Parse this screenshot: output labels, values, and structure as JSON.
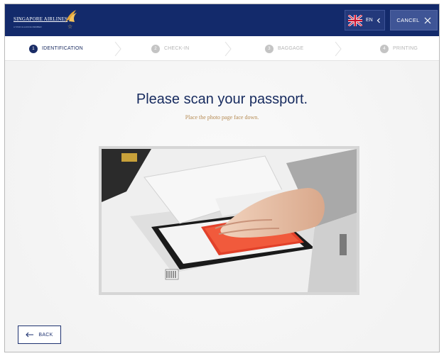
{
  "header": {
    "airline_name": "SINGAPORE AIRLINES",
    "tagline": "A STAR ALLIANCE MEMBER",
    "language_code": "EN",
    "cancel_label": "CANCEL"
  },
  "steps": [
    {
      "number": "1",
      "label": "IDENTIFICATION",
      "active": true
    },
    {
      "number": "2",
      "label": "CHECK-IN",
      "active": false
    },
    {
      "number": "3",
      "label": "BAGGAGE",
      "active": false
    },
    {
      "number": "4",
      "label": "PRINTING",
      "active": false
    }
  ],
  "main": {
    "title": "Please scan your passport.",
    "instruction": "Place the photo page face down."
  },
  "footer": {
    "back_label": "BACK"
  },
  "colors": {
    "brand_navy": "#132a6b",
    "brand_gold": "#d7b25d",
    "instruction_text": "#b58a52"
  }
}
